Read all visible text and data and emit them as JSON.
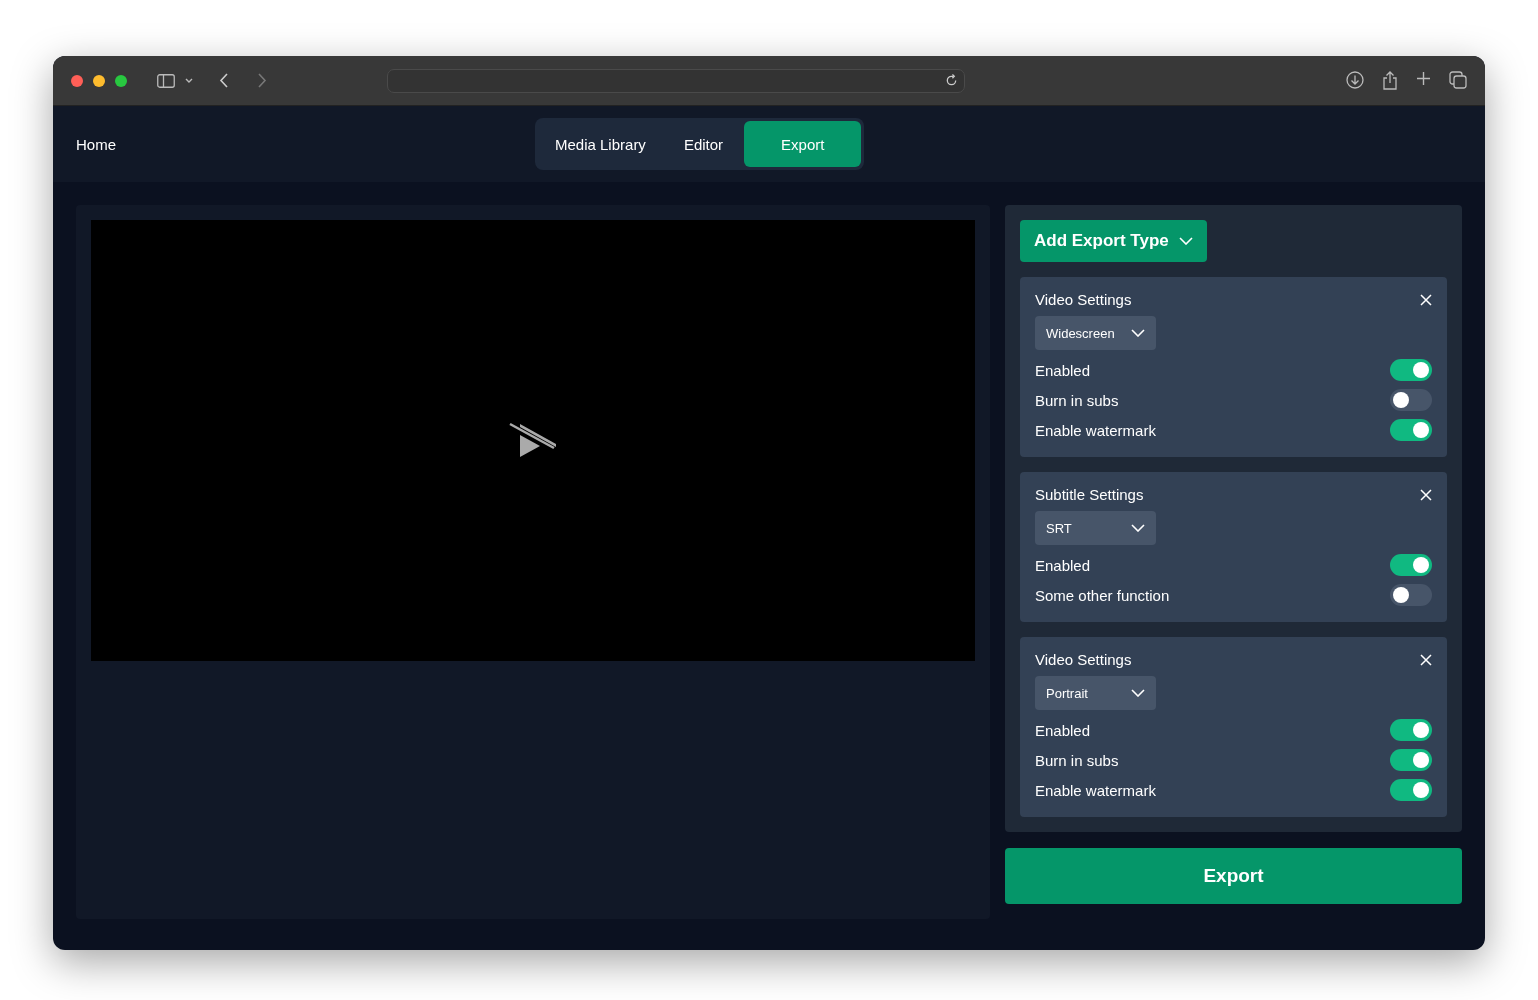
{
  "header": {
    "home": "Home",
    "tabs": [
      {
        "label": "Media Library",
        "selected": false
      },
      {
        "label": "Editor",
        "selected": false
      },
      {
        "label": "Export",
        "selected": true
      }
    ]
  },
  "add_button": "Add Export Type",
  "cards": [
    {
      "title": "Video Settings",
      "dropdown": "Widescreen",
      "toggles": [
        {
          "label": "Enabled",
          "on": true
        },
        {
          "label": "Burn in subs",
          "on": false
        },
        {
          "label": "Enable watermark",
          "on": true
        }
      ]
    },
    {
      "title": "Subtitle Settings",
      "dropdown": "SRT",
      "toggles": [
        {
          "label": "Enabled",
          "on": true
        },
        {
          "label": "Some other function",
          "on": false
        }
      ]
    },
    {
      "title": "Video Settings",
      "dropdown": "Portrait",
      "toggles": [
        {
          "label": "Enabled",
          "on": true
        },
        {
          "label": "Burn in subs",
          "on": true
        },
        {
          "label": "Enable watermark",
          "on": true
        }
      ]
    }
  ],
  "export_button": "Export"
}
